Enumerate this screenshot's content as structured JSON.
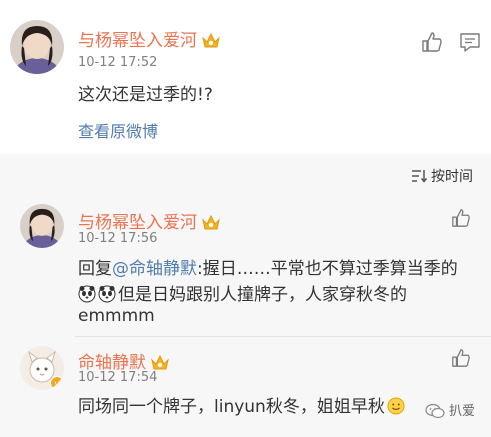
{
  "post": {
    "username": "与杨幂坠入爱河",
    "time": "10-12 17:52",
    "content": "这次还是过季的!?",
    "view_original": "查看原微博"
  },
  "sort": {
    "label": "按时间"
  },
  "comments": [
    {
      "username": "与杨幂坠入爱河",
      "time": "10-12 17:56",
      "line1_prefix": "回复",
      "line1_mention": "@命轴静默",
      "line1_rest": ":握日……平常也不算过季算当季的",
      "line2": "但是日妈跟别人撞牌子，人家穿秋冬的",
      "line3": "emmmm"
    },
    {
      "username": "命轴静默",
      "time": "10-12 17:54",
      "content": "同场同一个牌子，linyun秋冬，姐姐早秋"
    }
  ],
  "watermark": "扒爱",
  "colors": {
    "username": "#eb7350",
    "link": "#507daf",
    "comments_bg": "#f7f7f7"
  },
  "icons": [
    "thumb-up-icon",
    "comment-icon",
    "sort-icon",
    "crown-badge-icon",
    "panda-emoji-icon",
    "smile-emoji-icon"
  ]
}
